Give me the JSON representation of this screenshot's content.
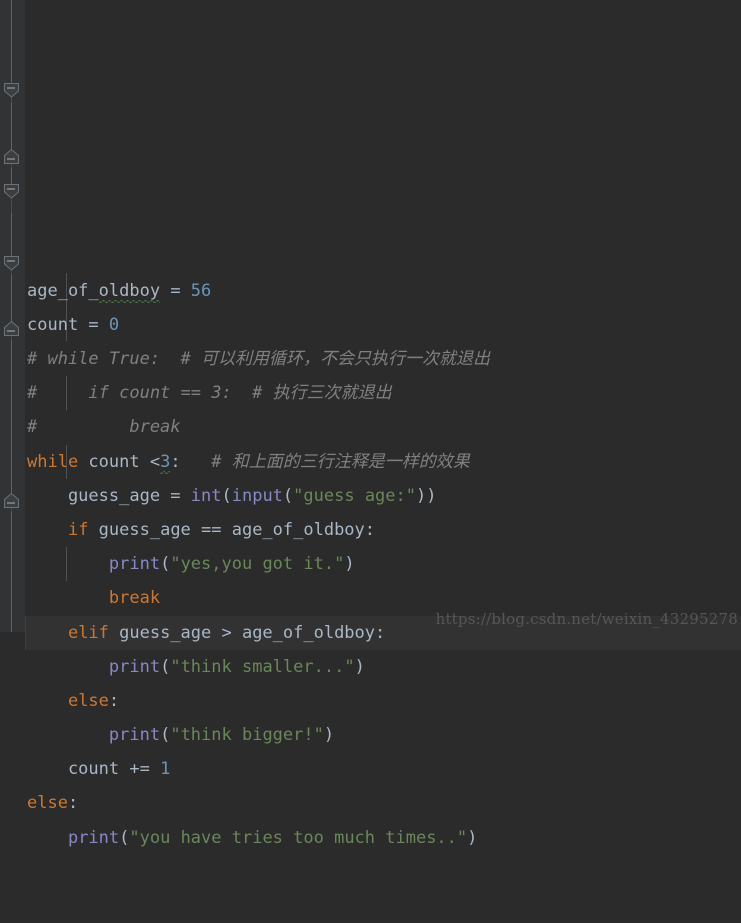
{
  "editor": {
    "theme_name": "darcula",
    "background": "#2b2b2b",
    "gutter_background": "#313335",
    "current_line_background": "#323232",
    "colors": {
      "keyword": "#cc7832",
      "identifier": "#a9b7c6",
      "number": "#6897bb",
      "string": "#6a8759",
      "function": "#8888c6",
      "comment": "#808080",
      "typo_underline": "#4f7a4f",
      "indent_guide": "#4f5254",
      "watermark": "#555759"
    }
  },
  "code_lines": [
    {
      "index": 0,
      "text": "age_of_oldboy = 56",
      "tokens": [
        {
          "t": "age_of_",
          "c": "ident"
        },
        {
          "t": "oldboy",
          "c": "ident typo"
        },
        {
          "t": " = ",
          "c": "op"
        },
        {
          "t": "56",
          "c": "num"
        }
      ]
    },
    {
      "index": 1,
      "text": "count = 0",
      "tokens": [
        {
          "t": "count = ",
          "c": "ident"
        },
        {
          "t": "0",
          "c": "num"
        }
      ]
    },
    {
      "index": 2,
      "text": "# while True:  # 可以利用循环，不会只执行一次就退出",
      "tokens": [
        {
          "t": "# while True:  # ",
          "c": "cmt"
        },
        {
          "t": "可以利用循环，不会只执行一次就退出",
          "c": "cmt-cn"
        }
      ]
    },
    {
      "index": 3,
      "text": "#     if count == 3:  # 执行三次就退出",
      "tokens": [
        {
          "t": "#     if count == 3:  # ",
          "c": "cmt"
        },
        {
          "t": "执行三次就退出",
          "c": "cmt-cn"
        }
      ]
    },
    {
      "index": 4,
      "text": "#         break",
      "tokens": [
        {
          "t": "#         break",
          "c": "cmt"
        }
      ]
    },
    {
      "index": 5,
      "text": "while count <3:   # 和上面的三行注释是一样的效果",
      "tokens": [
        {
          "t": "while",
          "c": "kw"
        },
        {
          "t": " count ",
          "c": "ident"
        },
        {
          "t": "<",
          "c": "op"
        },
        {
          "t": "3",
          "c": "num typo typo-sm"
        },
        {
          "t": ":   ",
          "c": "op"
        },
        {
          "t": "# ",
          "c": "cmt"
        },
        {
          "t": "和上面的三行注释是一样的效果",
          "c": "cmt-cn"
        }
      ]
    },
    {
      "index": 6,
      "text": "    guess_age = int(input(\"guess age:\"))",
      "tokens": [
        {
          "t": "    guess_age = ",
          "c": "ident"
        },
        {
          "t": "int",
          "c": "builtin"
        },
        {
          "t": "(",
          "c": "op"
        },
        {
          "t": "input",
          "c": "builtin"
        },
        {
          "t": "(",
          "c": "op"
        },
        {
          "t": "\"guess age:\"",
          "c": "str"
        },
        {
          "t": "))",
          "c": "op"
        }
      ]
    },
    {
      "index": 7,
      "text": "    if guess_age == age_of_oldboy:",
      "tokens": [
        {
          "t": "    ",
          "c": "op"
        },
        {
          "t": "if",
          "c": "kw"
        },
        {
          "t": " guess_age == age_of_oldboy:",
          "c": "ident"
        }
      ]
    },
    {
      "index": 8,
      "text": "        print(\"yes,you got it.\")",
      "tokens": [
        {
          "t": "        ",
          "c": "op"
        },
        {
          "t": "print",
          "c": "fn"
        },
        {
          "t": "(",
          "c": "op"
        },
        {
          "t": "\"yes,you got it.\"",
          "c": "str"
        },
        {
          "t": ")",
          "c": "op"
        }
      ]
    },
    {
      "index": 9,
      "text": "        break",
      "tokens": [
        {
          "t": "        ",
          "c": "op"
        },
        {
          "t": "break",
          "c": "kw"
        }
      ]
    },
    {
      "index": 10,
      "current": true,
      "text": "    elif guess_age > age_of_oldboy:",
      "tokens": [
        {
          "t": "    ",
          "c": "op"
        },
        {
          "t": "elif",
          "c": "kw"
        },
        {
          "t": " guess_age > age_of_oldboy:",
          "c": "ident"
        }
      ]
    },
    {
      "index": 11,
      "text": "        print(\"think smaller...\")",
      "tokens": [
        {
          "t": "        ",
          "c": "op"
        },
        {
          "t": "print",
          "c": "fn"
        },
        {
          "t": "(",
          "c": "op"
        },
        {
          "t": "\"think smaller...\"",
          "c": "str"
        },
        {
          "t": ")",
          "c": "op"
        }
      ]
    },
    {
      "index": 12,
      "text": "    else:",
      "tokens": [
        {
          "t": "    ",
          "c": "op"
        },
        {
          "t": "else",
          "c": "kw"
        },
        {
          "t": ":",
          "c": "ident"
        }
      ]
    },
    {
      "index": 13,
      "text": "        print(\"think bigger!\")",
      "tokens": [
        {
          "t": "        ",
          "c": "op"
        },
        {
          "t": "print",
          "c": "fn"
        },
        {
          "t": "(",
          "c": "op"
        },
        {
          "t": "\"think bigger!\"",
          "c": "str"
        },
        {
          "t": ")",
          "c": "op"
        }
      ]
    },
    {
      "index": 14,
      "text": "    count += 1",
      "tokens": [
        {
          "t": "    count += ",
          "c": "ident"
        },
        {
          "t": "1",
          "c": "num"
        }
      ]
    },
    {
      "index": 15,
      "text": "else:",
      "tokens": [
        {
          "t": "else",
          "c": "kw"
        },
        {
          "t": ":",
          "c": "ident"
        }
      ]
    },
    {
      "index": 16,
      "text": "    print(\"you have tries too much times..\")",
      "tokens": [
        {
          "t": "    ",
          "c": "op"
        },
        {
          "t": "print",
          "c": "fn"
        },
        {
          "t": "(",
          "c": "op"
        },
        {
          "t": "\"you have tries too much times..\"",
          "c": "str"
        },
        {
          "t": ")",
          "c": "op"
        }
      ]
    }
  ],
  "gutter": {
    "fold_markers": [
      {
        "type": "fold-collapse-down",
        "line": 2
      },
      {
        "type": "fold-collapse-end",
        "line": 4
      },
      {
        "type": "fold-collapse-down",
        "line": 5
      },
      {
        "type": "fold-collapse-down",
        "line": 7
      },
      {
        "type": "fold-collapse-end",
        "line": 9
      },
      {
        "type": "fold-collapse-end",
        "line": 14
      }
    ]
  },
  "watermark": {
    "url": "https://blog.csdn.net/weixin_43295278"
  }
}
